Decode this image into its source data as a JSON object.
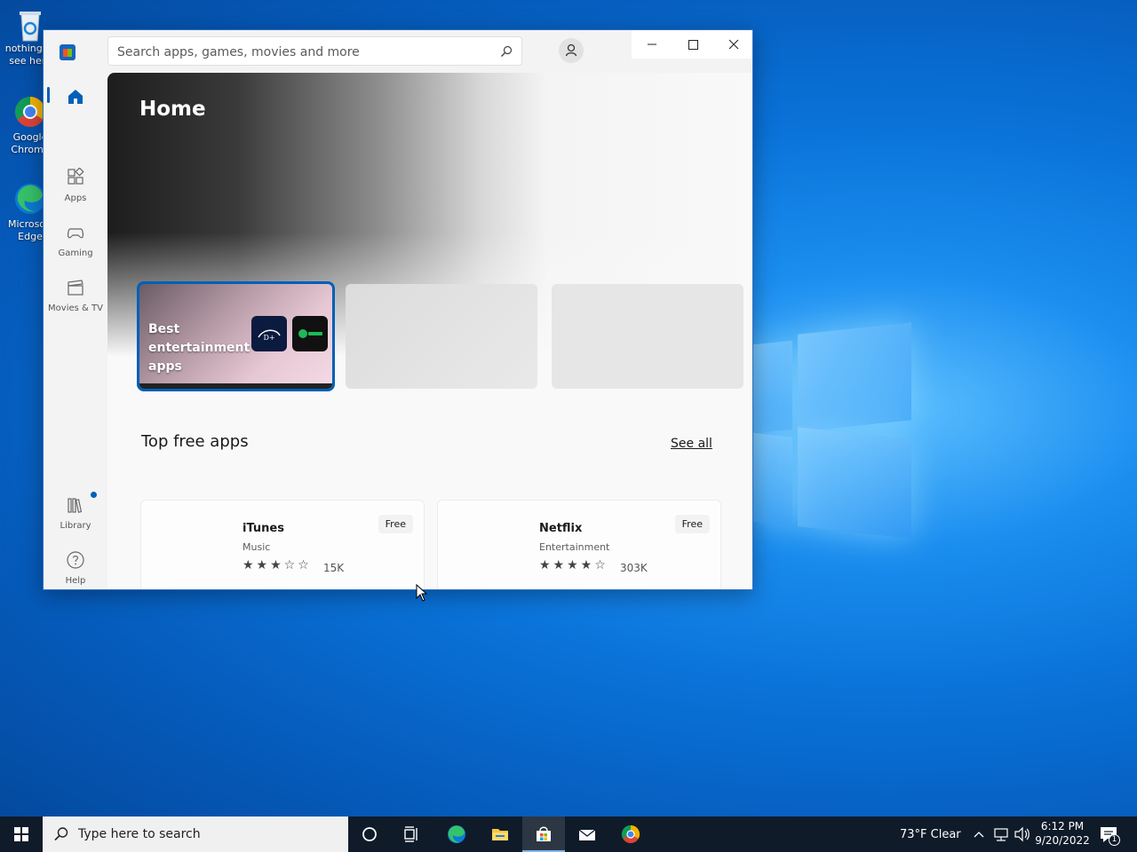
{
  "desktop": {
    "icons": [
      {
        "label": "nothing to see here"
      },
      {
        "label": "Google Chrome"
      },
      {
        "label": "Microsoft Edge"
      }
    ]
  },
  "window": {
    "search_placeholder": "Search apps, games, movies and more",
    "nav": {
      "home": "Home",
      "apps": "Apps",
      "gaming": "Gaming",
      "movies": "Movies & TV",
      "library": "Library",
      "help": "Help"
    },
    "hero": {
      "title": "Home",
      "featured_card": "Best entertainment apps"
    },
    "section": {
      "title": "Top free apps",
      "see_all": "See all"
    },
    "apps": [
      {
        "name": "iTunes",
        "category": "Music",
        "price": "Free",
        "rating": 3,
        "max_rating": 5,
        "stars": "★★★☆☆",
        "reviews": "15K"
      },
      {
        "name": "Netflix",
        "category": "Entertainment",
        "price": "Free",
        "rating": 4,
        "max_rating": 5,
        "stars": "★★★★☆",
        "reviews": "303K"
      }
    ]
  },
  "taskbar": {
    "search_placeholder": "Type here to search",
    "weather": "73°F  Clear",
    "time": "6:12 PM",
    "date": "9/20/2022",
    "notification_count": "1"
  },
  "colors": {
    "accent": "#005fb8",
    "taskbar": "#101b2a"
  }
}
